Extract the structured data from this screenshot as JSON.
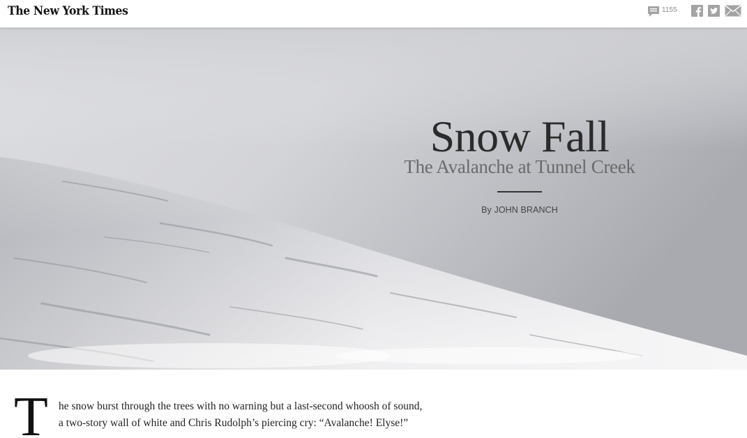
{
  "header": {
    "logo": "The New York Times",
    "comment_count": "1155",
    "comment_icon": "speech-bubble-icon",
    "share_icons": [
      "facebook-icon",
      "twitter-icon",
      "email-icon"
    ]
  },
  "hero": {
    "title": "Snow Fall",
    "subtitle": "The Avalanche at Tunnel Creek",
    "byline": "By JOHN BRANCH"
  },
  "article": {
    "dropcap": "T",
    "line1": "he snow burst through the trees with no warning but a last-second whoosh of sound,",
    "line2": "a two-story wall of white and Chris Rudolph’s piercing cry: “Avalanche! Elyse!”"
  },
  "colors": {
    "icon_gray": "#9b9b9b",
    "title": "#2b2b2b",
    "subtitle": "#6a6a6a"
  }
}
